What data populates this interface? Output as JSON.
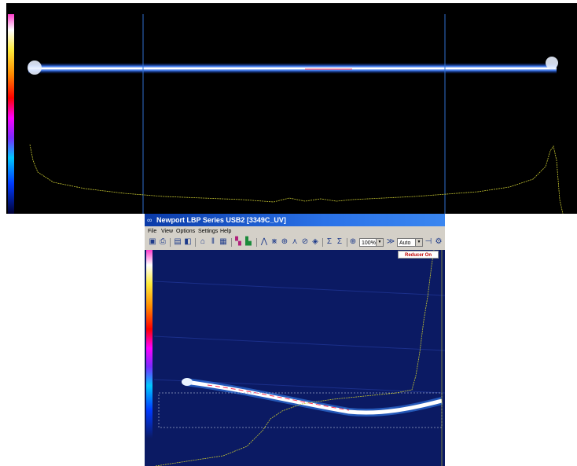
{
  "window": {
    "title": "Newport LBP Series USB2  [3349C_UV]",
    "icon": "camera-icon"
  },
  "menu": {
    "items": [
      {
        "label": "File"
      },
      {
        "label": "View"
      },
      {
        "label": "Options"
      },
      {
        "label": "Settings"
      },
      {
        "label": "Help"
      }
    ]
  },
  "toolbar": {
    "zoom_value": "100%",
    "gain_value": "Auto",
    "icons": [
      "open-icon",
      "print-icon",
      "save-icon",
      "capture-icon",
      "camera-icon",
      "freeze-icon",
      "settings-icon",
      "palette-icon",
      "background-icon",
      "profile-icon",
      "2d-icon",
      "crosshair-icon",
      "gaussian-icon",
      "ellipse-icon",
      "rotate-icon",
      "stats-icon",
      "scale-icon",
      "zoom-icon",
      "gain-icon",
      "options-icon"
    ]
  },
  "status": {
    "reducer": "Reducer On"
  },
  "colors": {
    "top_background": "#000000",
    "view_background": "#0b1a63",
    "cursor_line": "#2f6fd0",
    "profile_trace": "#c8c832"
  }
}
